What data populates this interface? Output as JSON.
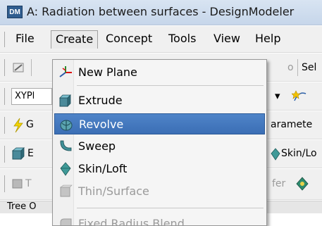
{
  "titlebar": {
    "app_badge": "DM",
    "title": "A: Radiation between surfaces - DesignModeler"
  },
  "menubar": {
    "items": [
      "File",
      "Create",
      "Concept",
      "Tools",
      "View",
      "Help"
    ]
  },
  "toolbar1": {
    "partial_text_1": "o",
    "partial_text_2": "Sel"
  },
  "toolbar2": {
    "plane_label": "XYPl",
    "dropdown_arrow": "▾"
  },
  "toolbar3": {
    "left_label": "G",
    "right_label": "aramete"
  },
  "toolbar4": {
    "left_label": "E",
    "right_label": "Skin/Lo"
  },
  "toolbar5": {
    "left_label": "T",
    "right_label": "fer"
  },
  "tree": {
    "label": "Tree O"
  },
  "create_menu": {
    "items": [
      {
        "label": "New Plane",
        "icon": "new-plane-icon",
        "state": "normal"
      },
      {
        "label": "Extrude",
        "icon": "extrude-icon",
        "state": "normal"
      },
      {
        "label": "Revolve",
        "icon": "revolve-icon",
        "state": "highlight"
      },
      {
        "label": "Sweep",
        "icon": "sweep-icon",
        "state": "normal"
      },
      {
        "label": "Skin/Loft",
        "icon": "skin-loft-icon",
        "state": "normal"
      },
      {
        "label": "Thin/Surface",
        "icon": "thin-surface-icon",
        "state": "disabled"
      },
      {
        "label": "Fixed Radius Blend",
        "icon": "fixed-radius-blend-icon",
        "state": "disabled"
      }
    ]
  },
  "colors": {
    "highlight": "#3b6eb5",
    "titlebar": "#c6d6ea",
    "menu_bg": "#f5f5f5",
    "toolbar_bg": "#f0f0f0"
  }
}
